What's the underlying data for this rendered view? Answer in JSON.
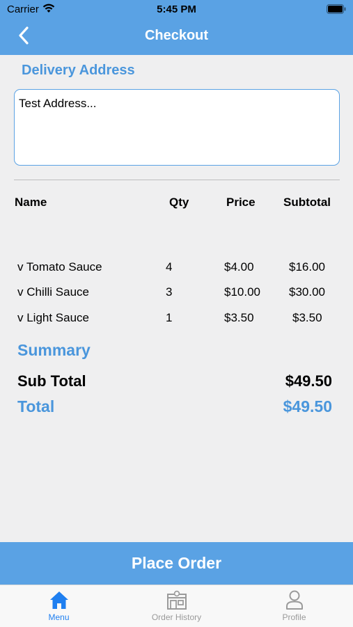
{
  "status": {
    "carrier": "Carrier",
    "time": "5:45 PM"
  },
  "nav": {
    "title": "Checkout",
    "back_icon": "chevron-left-icon"
  },
  "address": {
    "section_title": "Delivery Address",
    "value": "Test Address..."
  },
  "table": {
    "headers": {
      "name": "Name",
      "qty": "Qty",
      "price": "Price",
      "subtotal": "Subtotal"
    },
    "rows": [
      {
        "name": "v Tomato Sauce",
        "qty": "4",
        "price": "$4.00",
        "subtotal": "$16.00"
      },
      {
        "name": "v Chilli Sauce",
        "qty": "3",
        "price": "$10.00",
        "subtotal": "$30.00"
      },
      {
        "name": "v Light Sauce",
        "qty": "1",
        "price": "$3.50",
        "subtotal": "$3.50"
      }
    ]
  },
  "summary": {
    "title": "Summary",
    "subtotal_label": "Sub Total",
    "subtotal_value": "$49.50",
    "total_label": "Total",
    "total_value": "$49.50"
  },
  "place_order": {
    "label": "Place Order"
  },
  "tabs": [
    {
      "label": "Menu",
      "icon": "home-icon",
      "active": true
    },
    {
      "label": "Order History",
      "icon": "shop-icon",
      "active": false
    },
    {
      "label": "Profile",
      "icon": "person-icon",
      "active": false
    }
  ],
  "colors": {
    "accent": "#5aa2e4",
    "accent_text": "#4a96dc",
    "tab_active": "#1f7ff0",
    "background": "#efeff0"
  }
}
